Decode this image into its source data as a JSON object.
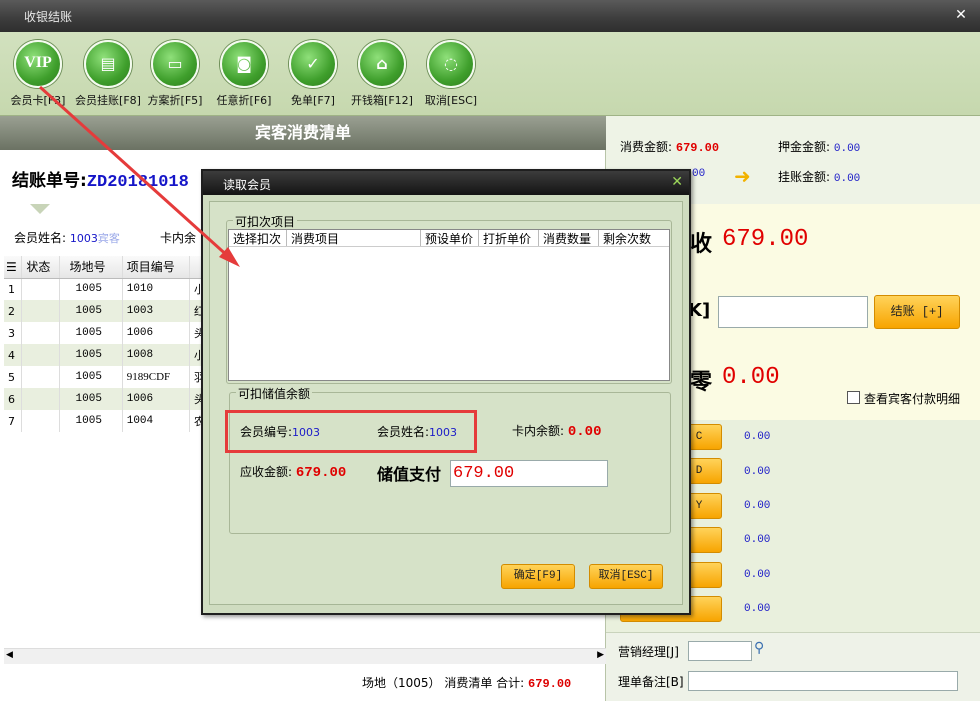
{
  "window": {
    "title": "收银结账"
  },
  "toolbar": {
    "buttons": [
      {
        "label": "会员卡[F3]",
        "icon": "VIP"
      },
      {
        "label": "会员挂账[F8]",
        "icon": "doc"
      },
      {
        "label": "方案折[F5]",
        "icon": "win"
      },
      {
        "label": "任意折[F6]",
        "icon": "bag"
      },
      {
        "label": "免单[F7]",
        "icon": "check"
      },
      {
        "label": "开钱箱[F12]",
        "icon": "box"
      },
      {
        "label": "取消[ESC]",
        "icon": "ring"
      }
    ]
  },
  "bill": {
    "header": "宾客消费清单",
    "number_label": "结账单号:",
    "number_value": "ZD20181018",
    "member_name_label": "会员姓名:",
    "member_name_value": "1003",
    "member_name_suffix": "宾客",
    "card_balance_label": "卡内余",
    "columns": [
      "状态",
      "场地号",
      "项目编号"
    ],
    "rows": [
      {
        "idx": "1",
        "venue": "1005",
        "code": "1010",
        "tail": "小"
      },
      {
        "idx": "2",
        "venue": "1005",
        "code": "1003",
        "tail": "红"
      },
      {
        "idx": "3",
        "venue": "1005",
        "code": "1006",
        "tail": "头"
      },
      {
        "idx": "4",
        "venue": "1005",
        "code": "1008",
        "tail": "小"
      },
      {
        "idx": "5",
        "venue": "1005",
        "code": "9189CDF",
        "tail": "羽"
      },
      {
        "idx": "6",
        "venue": "1005",
        "code": "1006",
        "tail": "头"
      },
      {
        "idx": "7",
        "venue": "1005",
        "code": "1004",
        "tail": "农"
      }
    ],
    "footer_prefix": "场地（1005） 消费清单 合计:",
    "footer_total": "679.00"
  },
  "summary": {
    "consume_label": "消费金额:",
    "consume_value": "679.00",
    "deposit_label": "押金金额:",
    "deposit_value": "0.00",
    "hidden_value": "00",
    "charge_label": "挂账金额:",
    "charge_value": "0.00"
  },
  "payment": {
    "receivable_char": "收",
    "receivable_value": "679.00",
    "bracket_char": "K]",
    "checkout_button": "结账 [+]",
    "change_char": "零",
    "change_value": "0.00",
    "view_detail_label": "查看宾客付款明细",
    "method_keys": [
      "C",
      "D",
      "Y",
      "",
      "",
      ""
    ],
    "method_values": [
      "0.00",
      "0.00",
      "0.00",
      "0.00",
      "0.00",
      "0.00"
    ]
  },
  "bottom": {
    "manager_label": "营销经理[J]",
    "remark_label": "理单备注[B]"
  },
  "modal": {
    "title": "读取会员",
    "group1_title": "可扣次项目",
    "list_columns": [
      "选择扣次",
      "消费项目",
      "预设单价",
      "打折单价",
      "消费数量",
      "剩余次数"
    ],
    "group2_title": "可扣储值余额",
    "member_no_label": "会员编号:",
    "member_no_value": "1003",
    "member_name_label": "会员姓名:",
    "member_name_value": "1003",
    "card_balance_label": "卡内余额:",
    "card_balance_value": "0.00",
    "receivable_label": "应收金额:",
    "receivable_value": "679.00",
    "stored_pay_label": "储值支付",
    "stored_pay_value": "679.00",
    "confirm_button": "确定[F9]",
    "cancel_button": "取消[ESC]"
  },
  "colors": {
    "accent_red": "#e00000",
    "accent_blue": "#1a1ac8",
    "annotation_red": "#e53b3b",
    "button_orange": "#f7a400"
  }
}
